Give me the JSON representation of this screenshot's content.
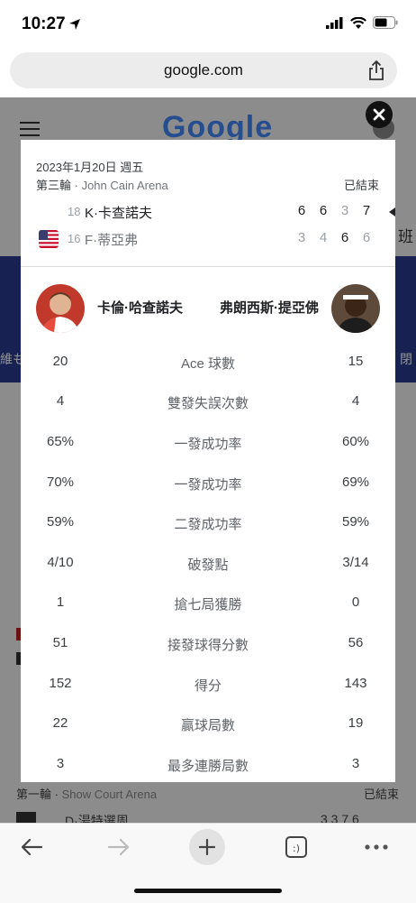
{
  "status_bar": {
    "time": "10:27"
  },
  "browser": {
    "url": "google.com"
  },
  "match": {
    "date": "2023年1月20日 週五",
    "round": "第三輪",
    "venue": "John Cain Arena",
    "status": "已結束",
    "player1": {
      "seed": "18",
      "name": "K·卡查諾夫",
      "sets": [
        "6",
        "6",
        "3",
        "7"
      ]
    },
    "player2": {
      "seed": "16",
      "name": "F·蒂亞弗",
      "sets": [
        "3",
        "4",
        "6",
        "6"
      ]
    }
  },
  "stats_header": {
    "left_player": "卡倫·哈查諾夫",
    "right_player": "弗朗西斯·提亞佛"
  },
  "stats": [
    {
      "label": "Ace 球數",
      "left": "20",
      "right": "15"
    },
    {
      "label": "雙發失誤次數",
      "left": "4",
      "right": "4"
    },
    {
      "label": "一發成功率",
      "left": "65%",
      "right": "60%"
    },
    {
      "label": "一發成功率",
      "left": "70%",
      "right": "69%"
    },
    {
      "label": "二發成功率",
      "left": "59%",
      "right": "59%"
    },
    {
      "label": "破發點",
      "left": "4/10",
      "right": "3/14"
    },
    {
      "label": "搶七局獲勝",
      "left": "1",
      "right": "0"
    },
    {
      "label": "接發球得分數",
      "left": "51",
      "right": "56"
    },
    {
      "label": "得分",
      "left": "152",
      "right": "143"
    },
    {
      "label": "贏球局數",
      "left": "22",
      "right": "19"
    },
    {
      "label": "最多連勝局數",
      "left": "3",
      "right": "3"
    }
  ],
  "background": {
    "logo": "Google",
    "side_right": "班",
    "side_left": "維も",
    "side_right2": "閉",
    "round_bottom": "第一輪",
    "venue_bottom": "Show Court Arena",
    "status_bottom": "已結束",
    "player_bottom": "D·湯特選周",
    "scores_bottom": "3  3  7  6"
  },
  "colors": {
    "dim_overlay": "#000000",
    "bg_blue": "#283b8d",
    "accent_google_blue": "#4285f4"
  },
  "icons": [
    "location-arrow-icon",
    "signal-icon",
    "wifi-icon",
    "battery-icon",
    "share-icon",
    "close-icon",
    "back-icon",
    "forward-icon",
    "new-tab-icon",
    "tabs-icon",
    "more-icon",
    "menu-icon"
  ]
}
